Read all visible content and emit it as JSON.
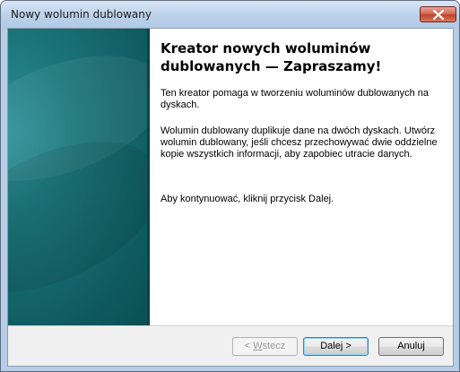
{
  "window": {
    "title": "Nowy wolumin dublowany"
  },
  "wizard": {
    "heading": "Kreator nowych woluminów dublowanych — Zapraszamy!",
    "paragraph1": "Ten kreator pomaga w tworzeniu woluminów dublowanych na dyskach.",
    "paragraph2": "Wolumin dublowany duplikuje dane na dwóch dyskach. Utwórz wolumin dublowany, jeśli chcesz przechowywać dwie oddzielne kopie wszystkich informacji, aby zapobiec utracie danych.",
    "paragraph3": "Aby kontynuować, kliknij przycisk Dalej."
  },
  "buttons": {
    "back_prefix": "< ",
    "back_mnemonic": "W",
    "back_rest": "stecz",
    "next_label": "Dalej >",
    "cancel_label": "Anuluj"
  },
  "icons": {
    "close": "close-icon"
  },
  "colors": {
    "close_button": "#c0432c",
    "side_panel": "#1b7579",
    "title_bar": "#bdd2ea"
  }
}
